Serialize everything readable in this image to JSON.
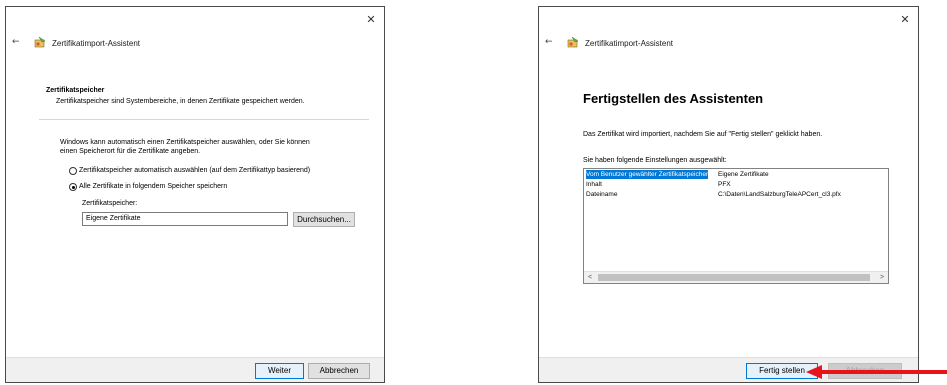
{
  "dialog1": {
    "close_glyph": "✕",
    "back_glyph": "←",
    "window_title": "Zertifikatimport-Assistent",
    "section_title": "Zertifikatspeicher",
    "section_desc": "Zertifikatspeicher sind Systembereiche, in denen Zertifikate gespeichert werden.",
    "info_line1": "Windows kann automatisch einen Zertifikatspeicher auswählen, oder Sie können",
    "info_line2": "einen Speicherort für die Zertifikate angeben.",
    "radio_auto": "Zertifikatspeicher automatisch auswählen (auf dem Zertifikattyp basierend)",
    "radio_manual": "Alle Zertifikate in folgendem Speicher speichern",
    "store_label": "Zertifikatspeicher:",
    "store_value": "Eigene Zertifikate",
    "browse_button": "Durchsuchen...",
    "next_button": "Weiter",
    "cancel_button": "Abbrechen"
  },
  "dialog2": {
    "close_glyph": "✕",
    "back_glyph": "←",
    "window_title": "Zertifikatimport-Assistent",
    "heading": "Fertigstellen des Assistenten",
    "info_text": "Das Zertifikat wird importiert, nachdem Sie auf \"Fertig stellen\" geklickt haben.",
    "settings_label": "Sie haben folgende Einstellungen ausgewählt:",
    "settings_rows": [
      {
        "key": "Vom Benutzer gewählter Zertifikatspeicher",
        "value": "Eigene Zertifikate",
        "selected": true
      },
      {
        "key": "Inhalt",
        "value": "PFX",
        "selected": false
      },
      {
        "key": "Dateiname",
        "value": "C:\\Daten\\LandSalzburgTeleAPCert_cl3.pfx",
        "selected": false
      }
    ],
    "scroll_left": "<",
    "scroll_right": ">",
    "finish_button": "Fertig stellen",
    "cancel_button": "Abbrechen"
  },
  "colors": {
    "accent": "#0078d7",
    "annotation_arrow": "#e8141b"
  },
  "icons": [
    "close-icon",
    "back-arrow-icon",
    "certificate-wizard-icon",
    "red-pointer-arrow"
  ]
}
